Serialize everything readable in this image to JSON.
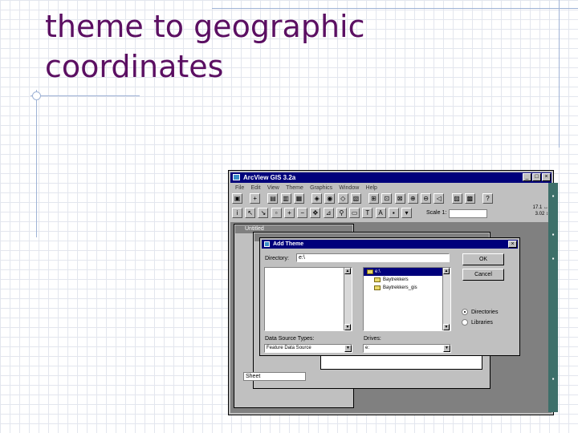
{
  "slide": {
    "title_line1": "theme to geographic",
    "title_line2": "coordinates"
  },
  "app": {
    "title": "ArcView GIS 3.2a",
    "menu": [
      "File",
      "Edit",
      "View",
      "Theme",
      "Graphics",
      "Window",
      "Help"
    ],
    "window_buttons": {
      "minimize": "_",
      "maximize": "□",
      "close": "×"
    },
    "scale_label": "Scale 1:",
    "scale_value": "",
    "coord_x": "17.1 ↔",
    "coord_y": "3.02 ↕",
    "project_window_title": "Untitled",
    "bottom_combo_value": "Sheet"
  },
  "dialog": {
    "title": "Add Theme",
    "close": "×",
    "directory_label": "Directory:",
    "directory_value": "e:\\",
    "ok_label": "OK",
    "cancel_label": "Cancel",
    "dir_tree": [
      {
        "label": "e:\\",
        "selected": true,
        "sub": false
      },
      {
        "label": "Baytrekkers",
        "selected": false,
        "sub": true
      },
      {
        "label": "Baytrekkers_gis",
        "selected": false,
        "sub": true
      }
    ],
    "radios": [
      {
        "label": "Directories",
        "checked": true
      },
      {
        "label": "Libraries",
        "checked": false
      }
    ],
    "data_source_label": "Data Source Types:",
    "data_source_value": "Feature Data Source",
    "drives_label": "Drives:",
    "drives_value": "e:"
  },
  "icons": [
    "app-icon",
    "save-icon",
    "add-theme-icon",
    "folder-icon",
    "zoom-in-icon",
    "zoom-out-icon",
    "pan-icon",
    "pointer-icon",
    "identify-icon",
    "help-icon",
    "scroll-arrow-icon",
    "radio-icon"
  ]
}
